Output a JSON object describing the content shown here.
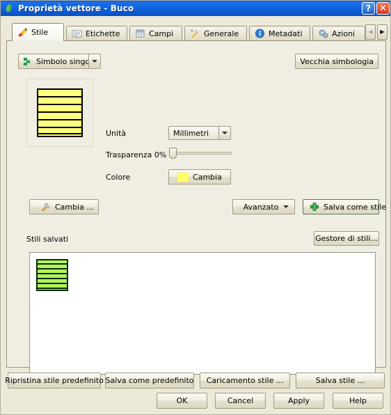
{
  "window": {
    "title": "Proprietà vettore - Buco",
    "app_icon": "qgis-leaf-icon",
    "help_button": "?",
    "close_button": "✕",
    "background_color": "#ece9d8",
    "titlebar_color": "#0f63e0"
  },
  "tabs": [
    {
      "label": "Stile",
      "icon": "paintbrush-icon",
      "active": true
    },
    {
      "label": "Etichette",
      "icon": "labels-icon",
      "active": false
    },
    {
      "label": "Campi",
      "icon": "table-icon",
      "active": false
    },
    {
      "label": "Generale",
      "icon": "tools-icon",
      "active": false
    },
    {
      "label": "Metadati",
      "icon": "info-icon",
      "active": false
    },
    {
      "label": "Azioni",
      "icon": "gears-icon",
      "active": false
    }
  ],
  "tab_nav": {
    "prev": "◀",
    "next": "▶",
    "prev_enabled": false,
    "next_enabled": true
  },
  "style_tab": {
    "renderer_selector": {
      "label": "Simbolo singolo",
      "icon": "single-symbol-icon",
      "dropdown_arrow": "▼"
    },
    "old_symbology_button": "Vecchia simbologia",
    "preview": {
      "fill_color": "#ffff80",
      "line_color": "#000000",
      "line_count": 6,
      "description": "yellow polygon with horizontal black hatch lines"
    },
    "properties": {
      "units_label": "Unità",
      "units_value": "Millimetri",
      "transparency_label": "Trasparenza 0%",
      "transparency_value": 0,
      "color_label": "Colore",
      "color_button": "Cambia",
      "color_value": "#ffff66"
    },
    "change_button": {
      "label": "Cambia ...",
      "icon": "wrench-icon"
    },
    "advanced_button": {
      "label": "Avanzato",
      "dropdown_arrow": "▼"
    },
    "save_style_button": {
      "label": "Salva come stile",
      "icon": "green-plus-icon"
    },
    "saved_styles": {
      "label": "Stili salvati",
      "manager_button": "Gestore di stili...",
      "items": [
        {
          "name": "style-swatch",
          "fill_color": "#b3f35a",
          "line_color": "#0c2a0c",
          "line_count": 6
        }
      ]
    }
  },
  "bottom_buttons": {
    "row1": [
      "Ripristina stile predefinito",
      "Salva come predefinito",
      "Caricamento stile ...",
      "Salva stile ..."
    ],
    "row2": [
      "OK",
      "Cancel",
      "Apply",
      "Help"
    ]
  }
}
